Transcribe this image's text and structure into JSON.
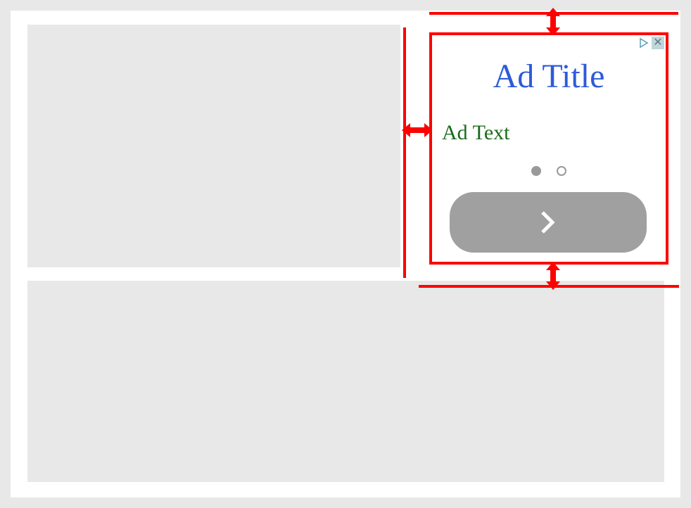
{
  "ad": {
    "title": "Ad Title",
    "body_text": "Ad Text",
    "pagination": {
      "dot_count": 2,
      "active_index": 0
    }
  },
  "annotations": {
    "margin_color": "#ff0000",
    "indicator_position": "top_right_float"
  }
}
